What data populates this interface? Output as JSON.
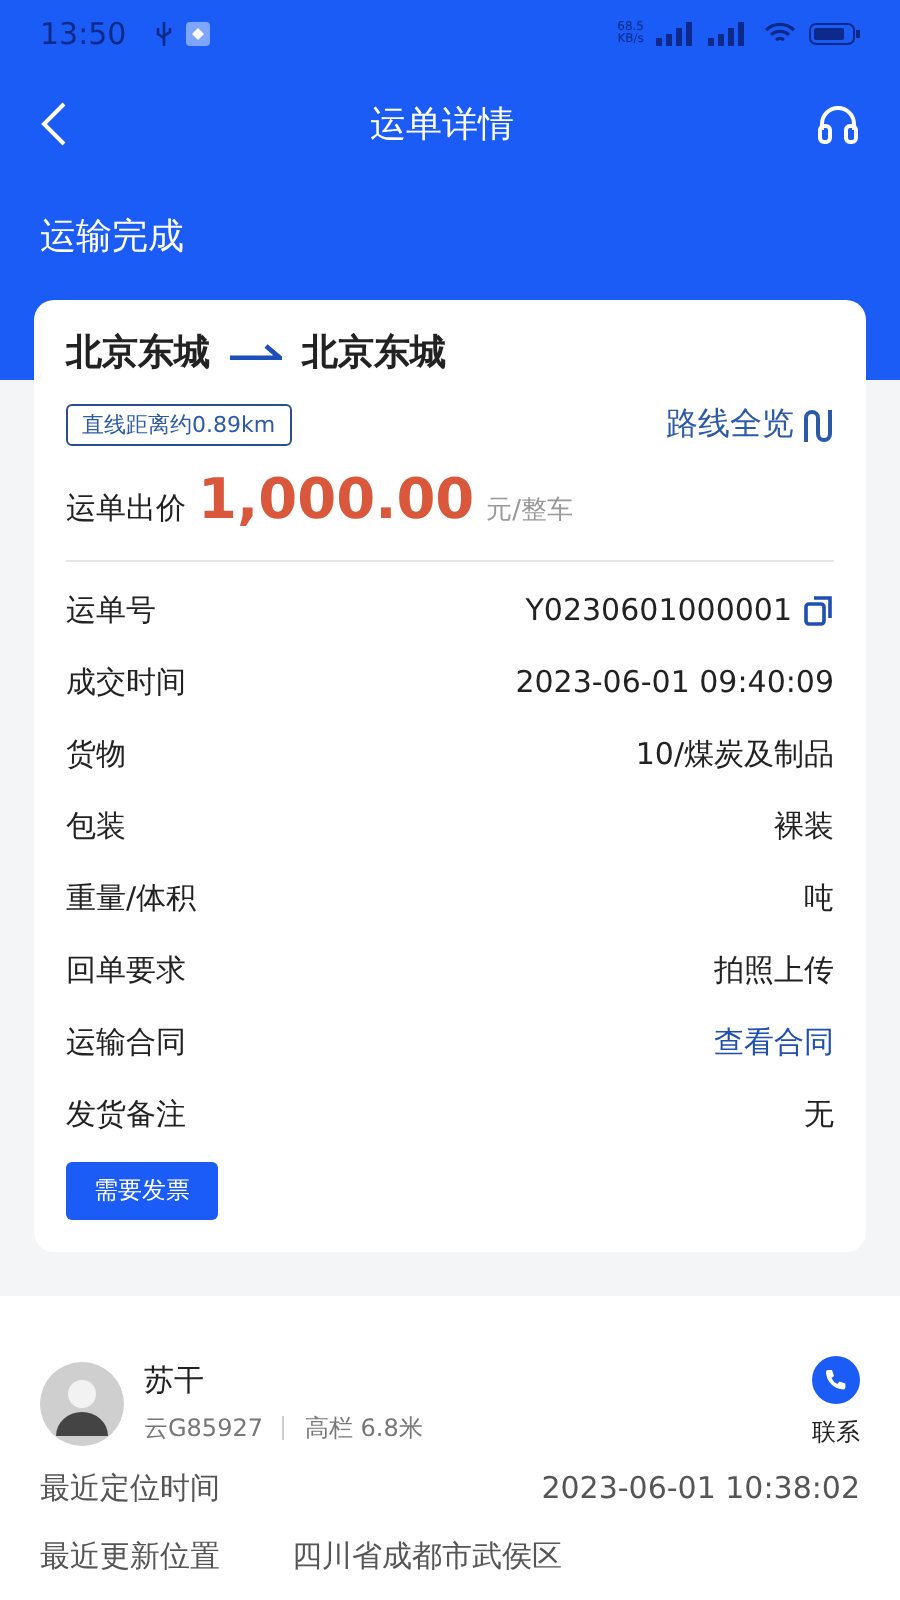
{
  "status_bar": {
    "time": "13:50",
    "network_speed": "68.5\nKB/s"
  },
  "nav": {
    "title": "运单详情"
  },
  "status": "运输完成",
  "route": {
    "from": "北京东城",
    "to": "北京东城",
    "distance": "直线距离约0.89km",
    "overview_link": "路线全览"
  },
  "price": {
    "label": "运单出价",
    "amount": "1,000.00",
    "unit": "元/整车"
  },
  "details": [
    {
      "label": "运单号",
      "value": "Y0230601000001",
      "kind": "copy"
    },
    {
      "label": "成交时间",
      "value": "2023-06-01 09:40:09",
      "kind": "text"
    },
    {
      "label": "货物",
      "value": "10/煤炭及制品",
      "kind": "text"
    },
    {
      "label": "包装",
      "value": "裸装",
      "kind": "text"
    },
    {
      "label": "重量/体积",
      "value": "吨",
      "kind": "text"
    },
    {
      "label": "回单要求",
      "value": "拍照上传",
      "kind": "text"
    },
    {
      "label": "运输合同",
      "value": "查看合同",
      "kind": "link"
    },
    {
      "label": "发货备注",
      "value": "无",
      "kind": "text"
    }
  ],
  "invoice_button": "需要发票",
  "driver": {
    "name": "苏干",
    "plate": "云G85927",
    "vehicle": "高栏 6.8米",
    "contact": "联系"
  },
  "location": [
    {
      "label": "最近定位时间",
      "value": "2023-06-01 10:38:02"
    },
    {
      "label": "最近更新位置",
      "value": "四川省成都市武侯区"
    }
  ]
}
